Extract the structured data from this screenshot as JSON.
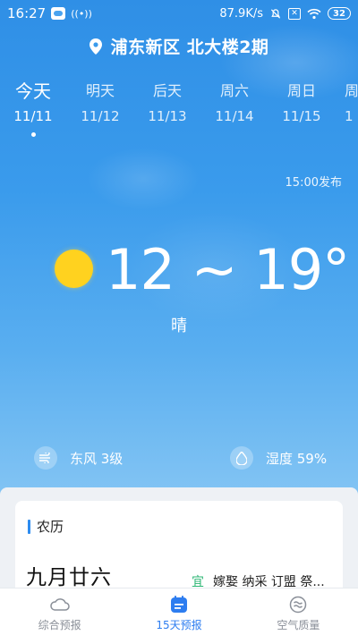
{
  "status_bar": {
    "time": "16:27",
    "net_speed": "87.9K/s",
    "battery": "32"
  },
  "location": {
    "name": "浦东新区 北大楼2期"
  },
  "days": [
    {
      "name": "今天",
      "date": "11/11",
      "active": true
    },
    {
      "name": "明天",
      "date": "11/12"
    },
    {
      "name": "后天",
      "date": "11/13"
    },
    {
      "name": "周六",
      "date": "11/14"
    },
    {
      "name": "周日",
      "date": "11/15"
    },
    {
      "name": "周",
      "date": "1"
    }
  ],
  "forecast": {
    "publish_time": "15:00发布",
    "temp_range": "12 ~ 19°",
    "condition": "晴",
    "condition_icon": "sun-icon",
    "wind": "东风 3级",
    "humidity": "湿度 59%"
  },
  "lunar": {
    "title": "农历",
    "date": "九月廿六",
    "yi_label": "宜",
    "yi_text": "嫁娶 纳采 订盟 祭..."
  },
  "nav": [
    {
      "label": "综合预报",
      "icon": "cloud-icon"
    },
    {
      "label": "15天预报",
      "icon": "calendar-icon",
      "active": true
    },
    {
      "label": "空气质量",
      "icon": "air-quality-icon"
    }
  ],
  "colors": {
    "accent": "#2d7df0",
    "sun": "#ffd21f",
    "yi_green": "#2bb673"
  }
}
